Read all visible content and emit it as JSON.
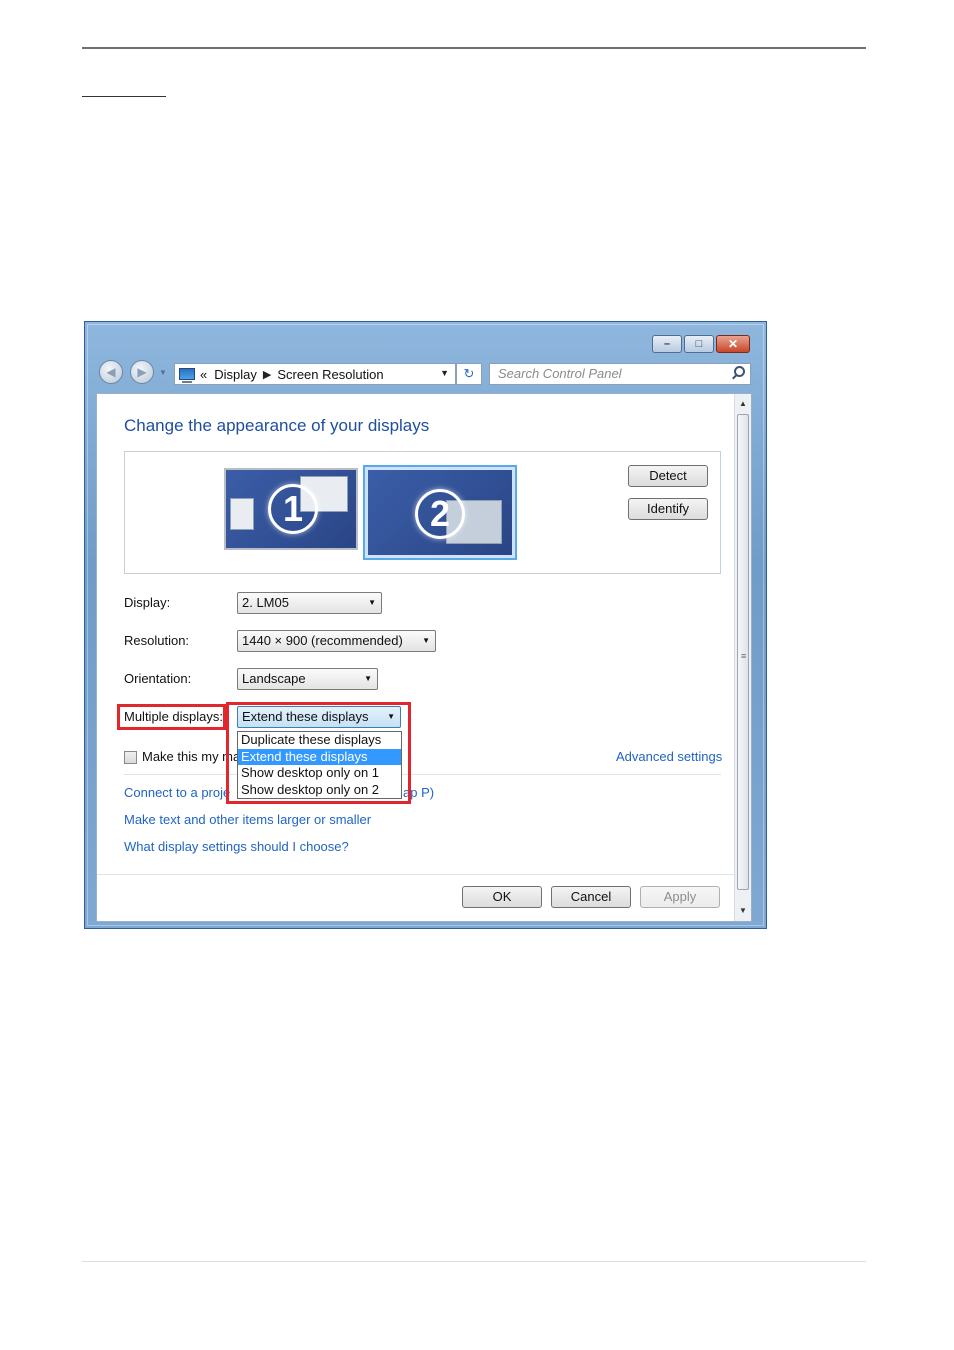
{
  "window": {
    "caption_buttons": {
      "minimize": "–",
      "maximize": "□",
      "close": "✕"
    }
  },
  "nav": {
    "back_icon": "◀",
    "forward_icon": "▶",
    "breadcrumb_prefix": "«",
    "breadcrumb": [
      "Display",
      "Screen Resolution"
    ],
    "breadcrumb_sep": "▶",
    "search_placeholder": "Search Control Panel"
  },
  "content": {
    "title": "Change the appearance of your displays",
    "monitors": [
      {
        "number": "1"
      },
      {
        "number": "2"
      }
    ],
    "buttons": {
      "detect": "Detect",
      "identify": "Identify"
    },
    "settings": {
      "display": {
        "label": "Display:",
        "value": "2. LM05"
      },
      "resolution": {
        "label": "Resolution:",
        "value": "1440 × 900 (recommended)"
      },
      "orientation": {
        "label": "Orientation:",
        "value": "Landscape"
      },
      "multiple": {
        "label": "Multiple displays:",
        "value": "Extend these displays"
      }
    },
    "dropdown_options": [
      "Duplicate these displays",
      "Extend these displays",
      "Show desktop only on 1",
      "Show desktop only on 2"
    ],
    "selected_option": "Extend these displays",
    "checkbox_label": "Make this my ma",
    "advanced_link": "Advanced settings",
    "links": {
      "connect": "Connect to a proje",
      "connect_tail": "ap P)",
      "text_size": "Make text and other items larger or smaller",
      "which_settings": "What display settings should I choose?"
    },
    "footer": {
      "ok": "OK",
      "cancel": "Cancel",
      "apply": "Apply"
    }
  },
  "colors": {
    "highlight_box": "#e2262d",
    "link": "#1f64c4",
    "title": "#1f4e9e",
    "selection": "#3399ff"
  }
}
